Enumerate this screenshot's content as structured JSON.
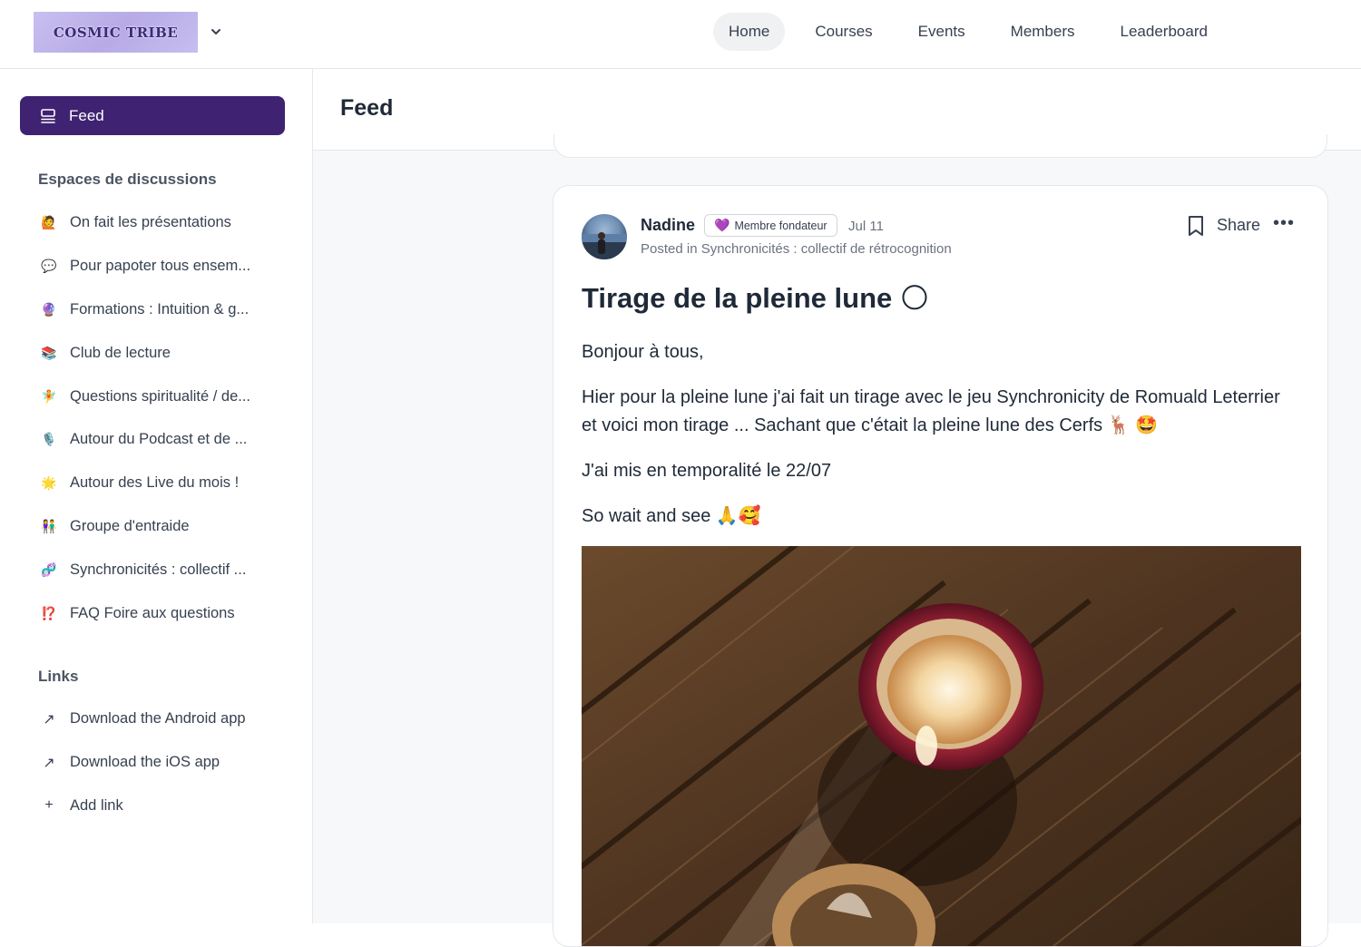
{
  "topbar": {
    "logo_text": "COSMIC TRIBE",
    "nav": [
      {
        "label": "Home",
        "active": true
      },
      {
        "label": "Courses",
        "active": false
      },
      {
        "label": "Events",
        "active": false
      },
      {
        "label": "Members",
        "active": false
      },
      {
        "label": "Leaderboard",
        "active": false
      }
    ]
  },
  "sidebar": {
    "feed_label": "Feed",
    "spaces_title": "Espaces de discussions",
    "spaces": [
      {
        "emoji": "🙋",
        "label": "On fait les présentations"
      },
      {
        "emoji": "💬",
        "label": "Pour papoter tous ensem..."
      },
      {
        "emoji": "🔮",
        "label": "Formations : Intuition & g..."
      },
      {
        "emoji": "📚",
        "label": "Club de lecture"
      },
      {
        "emoji": "🧚",
        "label": "Questions spiritualité / de..."
      },
      {
        "emoji": "🎙️",
        "label": "Autour du Podcast et de ..."
      },
      {
        "emoji": "🌟",
        "label": "Autour des Live du mois !"
      },
      {
        "emoji": "👫",
        "label": "Groupe d'entraide"
      },
      {
        "emoji": "🧬",
        "label": "Synchronicités : collectif ..."
      },
      {
        "emoji": "⁉️",
        "label": "FAQ Foire aux questions"
      }
    ],
    "links_title": "Links",
    "links": [
      {
        "icon": "↗",
        "label": "Download the Android app"
      },
      {
        "icon": "↗",
        "label": "Download the iOS app"
      },
      {
        "icon": "+",
        "label": "Add link"
      }
    ]
  },
  "main": {
    "header_title": "Feed",
    "post": {
      "author": "Nadine",
      "badge": "Membre fondateur",
      "badge_icon": "purple-heart",
      "date": "Jul 11",
      "posted_in": "Posted in Synchronicités : collectif de rétrocognition",
      "share_label": "Share",
      "title": "Tirage de la pleine lune 🌕",
      "paragraphs": [
        "Bonjour à tous,",
        "Hier pour la pleine lune j'ai fait un tirage avec le jeu Synchronicity de Romuald Leterrier et voici mon tirage ... Sachant que c'était la pleine lune  des Cerfs 🦌 🤩",
        "J'ai mis en temporalité le 22/07",
        "So wait and see 🙏🥰"
      ]
    }
  }
}
